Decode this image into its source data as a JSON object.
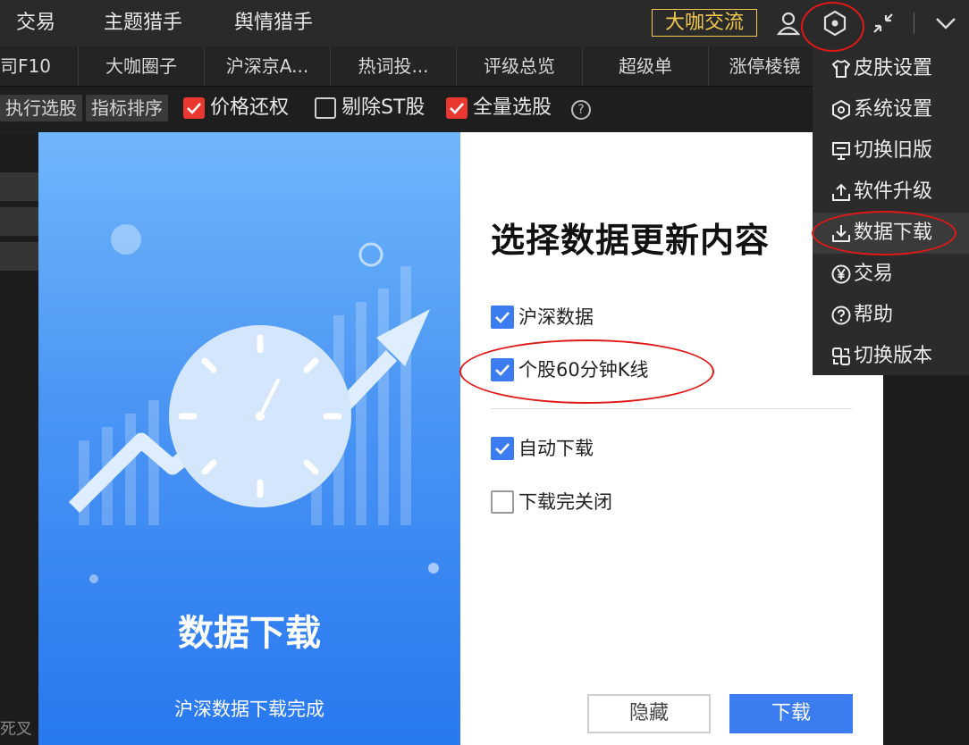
{
  "header": {
    "nav": [
      "交易",
      "主题猎手",
      "舆情猎手"
    ],
    "badge": "大咖交流"
  },
  "tabs": [
    "司F10",
    "大咖圈子",
    "沪深京A...",
    "热词投...",
    "评级总览",
    "超级单",
    "涨停棱镜"
  ],
  "toolbar": {
    "btn_execute": "执行选股",
    "btn_sort": "指标排序",
    "checks": [
      {
        "label": "价格还权",
        "checked": true
      },
      {
        "label": "剔除ST股",
        "checked": false
      },
      {
        "label": "全量选股",
        "checked": true
      }
    ],
    "help": "?"
  },
  "background": {
    "bottom_left_text": "死叉"
  },
  "dialog": {
    "title": "选择数据更新内容",
    "options": [
      {
        "label": "沪深数据",
        "checked": true
      },
      {
        "label": "个股60分钟K线",
        "checked": true
      },
      {
        "label": "自动下载",
        "checked": true
      },
      {
        "label": "下载完关闭",
        "checked": false
      }
    ],
    "left_title": "数据下载",
    "left_subtitle": "沪深数据下载完成",
    "hide_button": "隐藏",
    "download_button": "下载"
  },
  "menu": {
    "items": [
      {
        "label": "皮肤设置",
        "icon": "shirt-icon"
      },
      {
        "label": "系统设置",
        "icon": "hexagon-gear-icon"
      },
      {
        "label": "切换旧版",
        "icon": "monitor-icon"
      },
      {
        "label": "软件升级",
        "icon": "upload-icon"
      },
      {
        "label": "数据下载",
        "icon": "download-icon"
      },
      {
        "label": "交易",
        "icon": "yen-icon"
      },
      {
        "label": "帮助",
        "icon": "help-icon"
      },
      {
        "label": "切换版本",
        "icon": "switch-icon"
      }
    ]
  },
  "colors": {
    "accent_blue": "#3b7cf0",
    "checkbox_red": "#e8382f",
    "badge_gold": "#f2c94c",
    "annotation_red": "#e01818"
  }
}
